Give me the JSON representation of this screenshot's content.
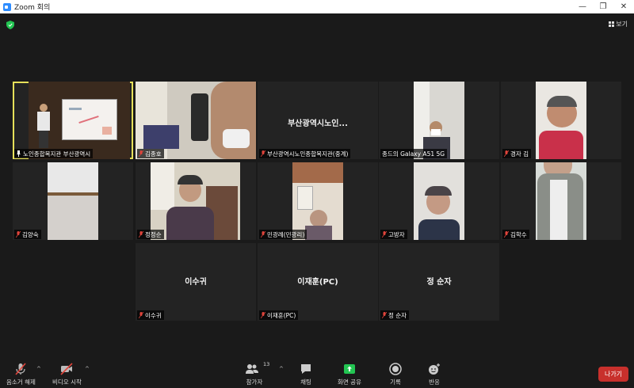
{
  "window": {
    "title": "Zoom 회의",
    "minimize": "—",
    "restore": "❐",
    "close": "✕"
  },
  "header": {
    "view_label": "보기"
  },
  "tiles": [
    {
      "label": "노인종합복지관 부산광역시",
      "center": ""
    },
    {
      "label": "김종호",
      "center": ""
    },
    {
      "label": "부산광역시노인종합복지관(중계)",
      "center": "부산광역시노인..."
    },
    {
      "label": "종드의 Galaxy A51 5G",
      "center": ""
    },
    {
      "label": "경자 김",
      "center": ""
    },
    {
      "label": "김양숙",
      "center": ""
    },
    {
      "label": "정정순",
      "center": ""
    },
    {
      "label": "민광례(민광리)",
      "center": ""
    },
    {
      "label": "고방자",
      "center": ""
    },
    {
      "label": "김학수",
      "center": ""
    },
    {
      "label": "이수귀",
      "center": "이수귀"
    },
    {
      "label": "이재훈(PC)",
      "center": "이재훈(PC)"
    },
    {
      "label": "정 순자",
      "center": "정 순자"
    }
  ],
  "toolbar": {
    "mute": "음소거 해제",
    "video": "비디오 시작",
    "participants": "참가자",
    "participants_count": "13",
    "chat": "채팅",
    "share": "화면 공유",
    "record": "기록",
    "reactions": "반응",
    "leave": "나가기",
    "caret": "^"
  },
  "colors": {
    "active_border": "#e6e05a",
    "share_green": "#23c552",
    "leave_red": "#c8302c",
    "mic_red": "#e0443b"
  }
}
